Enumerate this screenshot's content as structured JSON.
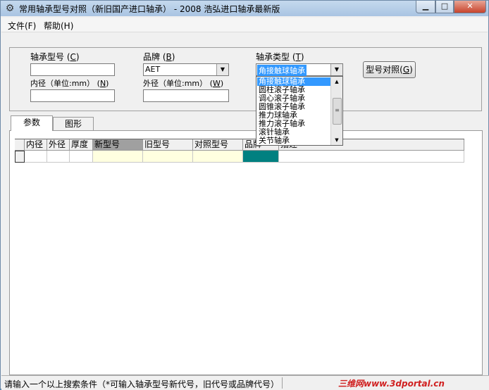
{
  "window": {
    "title": "常用轴承型号对照（新旧国产进口轴承） - 2008 浩弘进口轴承最新版",
    "icon": "gear-icon"
  },
  "menu": {
    "items": [
      "文件(F)",
      "帮助(H)"
    ]
  },
  "search": {
    "bearing_model_label": "轴承型号",
    "bearing_model_key": "C",
    "bearing_model_value": "",
    "brand_label": "品牌",
    "brand_key": "B",
    "brand_value": "AET",
    "bearing_type_label": "轴承类型",
    "bearing_type_key": "T",
    "bearing_type_value": "角接触球轴承",
    "inner_label": "内径（单位:mm）",
    "inner_key": "N",
    "inner_value": "",
    "outer_label": "外径（单位:mm）",
    "outer_key": "W",
    "outer_value": "",
    "compare_button_label": "型号对照",
    "compare_button_key": "G"
  },
  "bearing_type_dropdown": {
    "options": [
      "角接触球轴承",
      "圆柱滚子轴承",
      "调心滚子轴承",
      "圆锥滚子轴承",
      "推力球轴承",
      "推力滚子轴承",
      "滚针轴承",
      "关节轴承"
    ],
    "selected_index": 0
  },
  "tabs": [
    "参数",
    "图形"
  ],
  "table": {
    "columns": [
      "内径",
      "外径",
      "厚度",
      "新型号",
      "旧型号",
      "对照型号",
      "品牌",
      "描述"
    ],
    "rows": [
      [
        "",
        "",
        "",
        "",
        "",
        "",
        "",
        ""
      ]
    ]
  },
  "status": {
    "text": "请输入一个以上搜索条件（*可输入轴承型号新代号，旧代号或品牌代号）",
    "watermark": "三维网www.3dportal.cn"
  },
  "colors": {
    "selection": "#3399ff",
    "brand_cell": "#008080",
    "new_model_cell": "#ffffe0"
  }
}
